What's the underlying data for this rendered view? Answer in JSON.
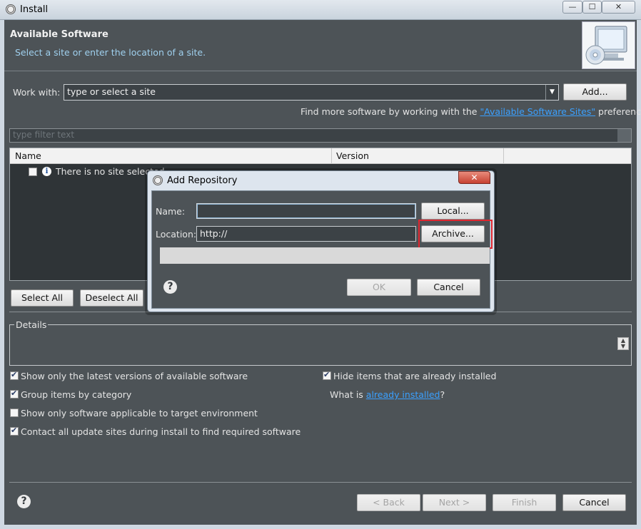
{
  "window": {
    "title": "Install",
    "controls": {
      "minimize": "—",
      "maximize": "☐",
      "close": "✕"
    }
  },
  "header": {
    "title": "Available Software",
    "subtitle": "Select a site or enter the location of a site."
  },
  "work_with": {
    "label": "Work with:",
    "value": "type or select a site",
    "add_button": "Add...",
    "hint_prefix": "Find more software by working with the ",
    "hint_link": "\"Available Software Sites\"",
    "hint_suffix": " preferences."
  },
  "filter": {
    "placeholder": "type filter text"
  },
  "table": {
    "columns": [
      "Name",
      "Version"
    ],
    "rows": [
      {
        "text": "There is no site selected."
      }
    ]
  },
  "selection_buttons": {
    "select_all": "Select All",
    "deselect_all": "Deselect All"
  },
  "details": {
    "label": "Details"
  },
  "options": {
    "left": [
      {
        "label": "Show only the latest versions of available software",
        "checked": true
      },
      {
        "label": "Group items by category",
        "checked": true
      },
      {
        "label": "Show only software applicable to target environment",
        "checked": false
      },
      {
        "label": "Contact all update sites during install to find required software",
        "checked": true
      }
    ],
    "right": [
      {
        "label": "Hide items that are already installed",
        "checked": true
      }
    ],
    "what_is_prefix": "What is ",
    "what_is_link": "already installed",
    "what_is_suffix": "?"
  },
  "footer": {
    "back": "< Back",
    "next": "Next >",
    "finish": "Finish",
    "cancel": "Cancel"
  },
  "dialog": {
    "title": "Add Repository",
    "close": "✕",
    "name_label": "Name:",
    "name_value": "",
    "local_button": "Local...",
    "location_label": "Location:",
    "location_value": "http://",
    "archive_button": "Archive...",
    "ok_button": "OK",
    "cancel_button": "Cancel"
  },
  "colors": {
    "background": "#4d5357",
    "link": "#3aa0ff",
    "subtitle": "#9fd0ee",
    "highlight": "#e0262f"
  },
  "icons": [
    "eclipse-gear-icon",
    "install-cd-icon",
    "info-icon",
    "help-icon"
  ]
}
